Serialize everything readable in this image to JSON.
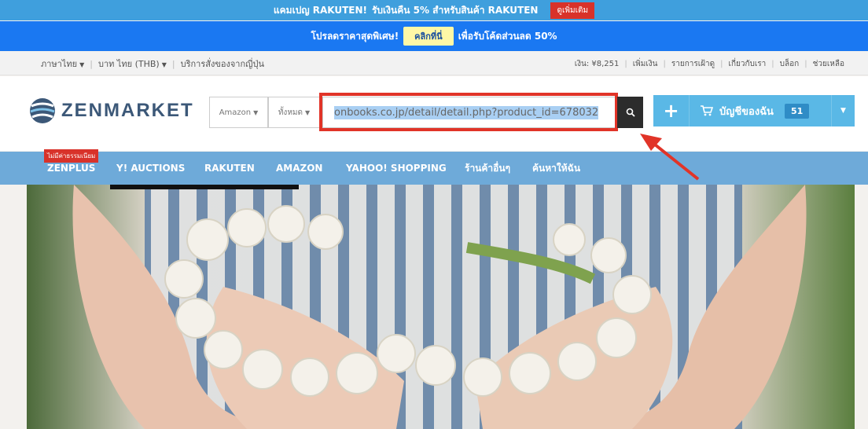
{
  "promo_top": {
    "text1": "แคมเปญ RAKUTEN!",
    "text2": "รับเงินคืน 5% สำหรับสินค้า RAKUTEN",
    "more": "ดูเพิ่มเติม"
  },
  "promo_second": {
    "text1": "โปรลดราคาสุดพิเศษ!",
    "click": "คลิกที่นี่",
    "text2": "เพื่อรับโค้ดส่วนลด 50%"
  },
  "util_left": {
    "language": "ภาษาไทย",
    "currency": "บาท ไทย (THB)",
    "service": "บริการสั่งของจากญี่ปุ่น"
  },
  "util_right": {
    "balance": "เงิน: ¥8,251",
    "topup": "เพิ่มเงิน",
    "watchlist": "รายการเฝ้าดู",
    "about": "เกี่ยวกับเรา",
    "blog": "บล็อก",
    "help": "ช่วยเหลือ"
  },
  "logo": {
    "text": "ZENMARKET"
  },
  "search": {
    "store": "Amazon",
    "category": "ทั้งหมด",
    "value": "onbooks.co.jp/detail/detail.php?product_id=678032"
  },
  "account": {
    "label": "บัญชีของฉัน",
    "count": "51"
  },
  "nav": {
    "tag": "ไม่มีค่าธรรมเนียม",
    "items": [
      "ZENPLUS",
      "Y! AUCTIONS",
      "RAKUTEN",
      "AMAZON",
      "YAHOO! SHOPPING",
      "ร้านค้าอื่นๆ",
      "ค้นหาให้ฉัน"
    ]
  },
  "colors": {
    "promo_top": "#3f9fdd",
    "promo_second": "#1a78f2",
    "nav": "#6eaad9",
    "account": "#5ab8e6",
    "highlight": "#e13428"
  }
}
